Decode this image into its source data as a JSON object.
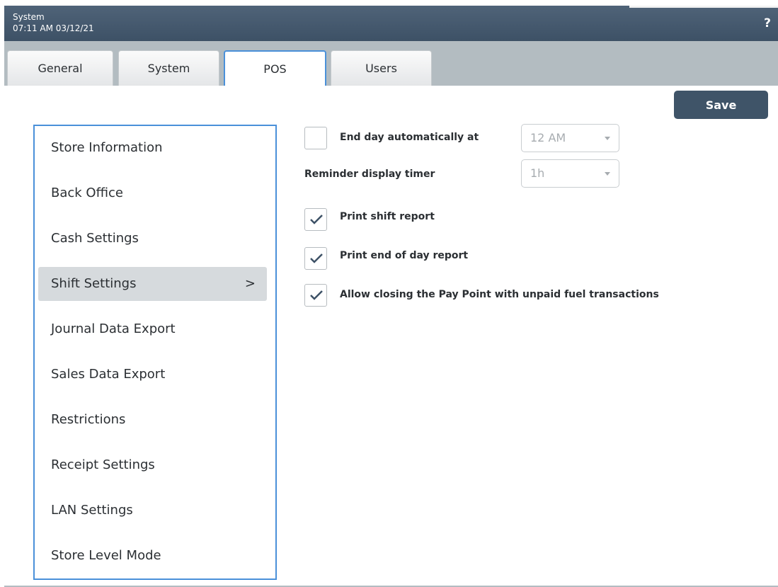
{
  "titlebar": {
    "title": "System",
    "datetime": "07:11 AM 03/12/21",
    "help_label": "?"
  },
  "tabs": [
    {
      "label": "General"
    },
    {
      "label": "System"
    },
    {
      "label": "POS",
      "active": true
    },
    {
      "label": "Users"
    }
  ],
  "toolbar": {
    "save_label": "Save"
  },
  "sidebar": {
    "items": [
      {
        "label": "Store Information"
      },
      {
        "label": "Back Office"
      },
      {
        "label": "Cash Settings"
      },
      {
        "label": "Shift Settings",
        "selected": true,
        "chevron": ">"
      },
      {
        "label": "Journal Data Export"
      },
      {
        "label": "Sales Data Export"
      },
      {
        "label": "Restrictions"
      },
      {
        "label": "Receipt Settings"
      },
      {
        "label": "LAN Settings"
      },
      {
        "label": "Store Level Mode"
      }
    ]
  },
  "settings": {
    "end_day": {
      "label": "End day automatically at",
      "checked": false,
      "value": "12 AM"
    },
    "reminder": {
      "label": "Reminder display timer",
      "value": "1h"
    },
    "print_shift": {
      "label": "Print shift report",
      "checked": true
    },
    "print_eod": {
      "label": "Print end of day report",
      "checked": true
    },
    "allow_closing": {
      "label": "Allow closing the Pay Point with unpaid fuel transactions",
      "checked": true
    }
  },
  "colors": {
    "titlebar": "#3d5166",
    "accent_border": "#4a90d9",
    "save_button": "#3f5468",
    "selected_item": "#d6dadd",
    "frame": "#b3bcc1"
  }
}
